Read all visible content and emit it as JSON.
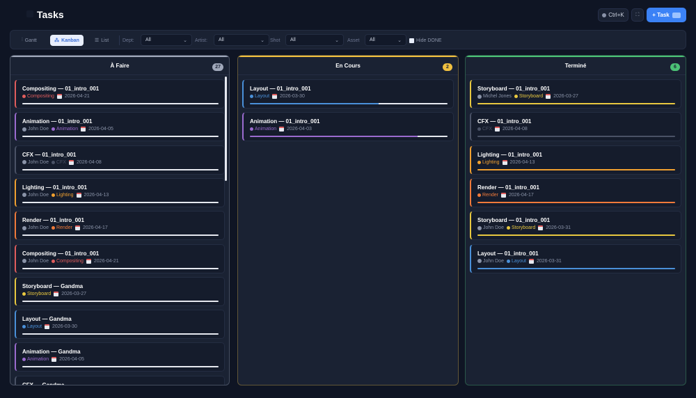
{
  "app": {
    "title": "Tasks"
  },
  "header": {
    "shortcut_label": "Ctrl+K",
    "add_task_label": "+ Task"
  },
  "toolbar": {
    "views": [
      {
        "label": "Gantt",
        "icon": "gantt-icon",
        "active": false
      },
      {
        "label": "Kanban",
        "icon": "kanban-icon",
        "active": true
      },
      {
        "label": "List",
        "icon": "list-icon",
        "active": false
      }
    ],
    "filters": [
      {
        "label": "Dept:",
        "value": "All"
      },
      {
        "label": "Artist:",
        "value": "All"
      },
      {
        "label": "Shot",
        "value": "All"
      },
      {
        "label": "Asset",
        "value": "All"
      }
    ],
    "hide_done_label": "Hide DONE"
  },
  "colors": {
    "Compositing": "#e05d5d",
    "Animation": "#9b6bcf",
    "CFX": "#4a5266",
    "Lighting": "#f0a030",
    "Render": "#f07a3a",
    "Storyboard": "#e8c840",
    "Layout": "#4a90d9",
    "todo": "#a0a8ba",
    "doing": "#f0c040",
    "done": "#4cc276"
  },
  "columns": [
    {
      "title": "À Faire",
      "count": "27",
      "color_key": "todo",
      "cards": [
        {
          "title": "Compositing — 01_intro_001",
          "artist": "",
          "dept": "Compositing",
          "date": "2026-04-21",
          "progress": 1.0
        },
        {
          "title": "Animation — 01_intro_001",
          "artist": "John Doe",
          "dept": "Animation",
          "date": "2026-04-05",
          "progress": 1.0
        },
        {
          "title": "CFX — 01_intro_001",
          "artist": "John Doe",
          "dept": "CFX",
          "date": "2026-04-08",
          "progress": 1.0
        },
        {
          "title": "Lighting — 01_intro_001",
          "artist": "John Doe",
          "dept": "Lighting",
          "date": "2026-04-13",
          "progress": 1.0
        },
        {
          "title": "Render — 01_intro_001",
          "artist": "John Doe",
          "dept": "Render",
          "date": "2026-04-17",
          "progress": 1.0
        },
        {
          "title": "Compositing — 01_intro_001",
          "artist": "John Doe",
          "dept": "Compositing",
          "date": "2026-04-21",
          "progress": 1.0
        },
        {
          "title": "Storyboard — Gandma",
          "artist": "",
          "dept": "Storyboard",
          "date": "2026-03-27",
          "progress": 1.0
        },
        {
          "title": "Layout — Gandma",
          "artist": "",
          "dept": "Layout",
          "date": "2026-03-30",
          "progress": 1.0
        },
        {
          "title": "Animation — Gandma",
          "artist": "",
          "dept": "Animation",
          "date": "2026-04-05",
          "progress": 1.0
        },
        {
          "title": "CFX — Gandma",
          "artist": "",
          "dept": "",
          "date": "",
          "progress": 0
        }
      ]
    },
    {
      "title": "En Cours",
      "count": "2",
      "color_key": "doing",
      "cards": [
        {
          "title": "Layout — 01_intro_001",
          "artist": "",
          "dept": "Layout",
          "date": "2026-03-30",
          "progress": 0.65
        },
        {
          "title": "Animation — 01_intro_001",
          "artist": "",
          "dept": "Animation",
          "date": "2026-04-03",
          "progress": 0.85
        }
      ]
    },
    {
      "title": "Terminé",
      "count": "6",
      "color_key": "done",
      "cards": [
        {
          "title": "Storyboard — 01_intro_001",
          "artist": "Michel Jones",
          "dept": "Storyboard",
          "date": "2026-03-27",
          "progress": 1.0
        },
        {
          "title": "CFX — 01_intro_001",
          "artist": "",
          "dept": "CFX",
          "date": "2026-04-08",
          "progress": 1.0
        },
        {
          "title": "Lighting — 01_intro_001",
          "artist": "",
          "dept": "Lighting",
          "date": "2026-04-13",
          "progress": 1.0
        },
        {
          "title": "Render — 01_intro_001",
          "artist": "",
          "dept": "Render",
          "date": "2026-04-17",
          "progress": 1.0
        },
        {
          "title": "Storyboard — 01_intro_001",
          "artist": "John Doe",
          "dept": "Storyboard",
          "date": "2026-03-31",
          "progress": 1.0
        },
        {
          "title": "Layout — 01_intro_001",
          "artist": "John Doe",
          "dept": "Layout",
          "date": "2026-03-31",
          "progress": 1.0
        }
      ]
    }
  ]
}
